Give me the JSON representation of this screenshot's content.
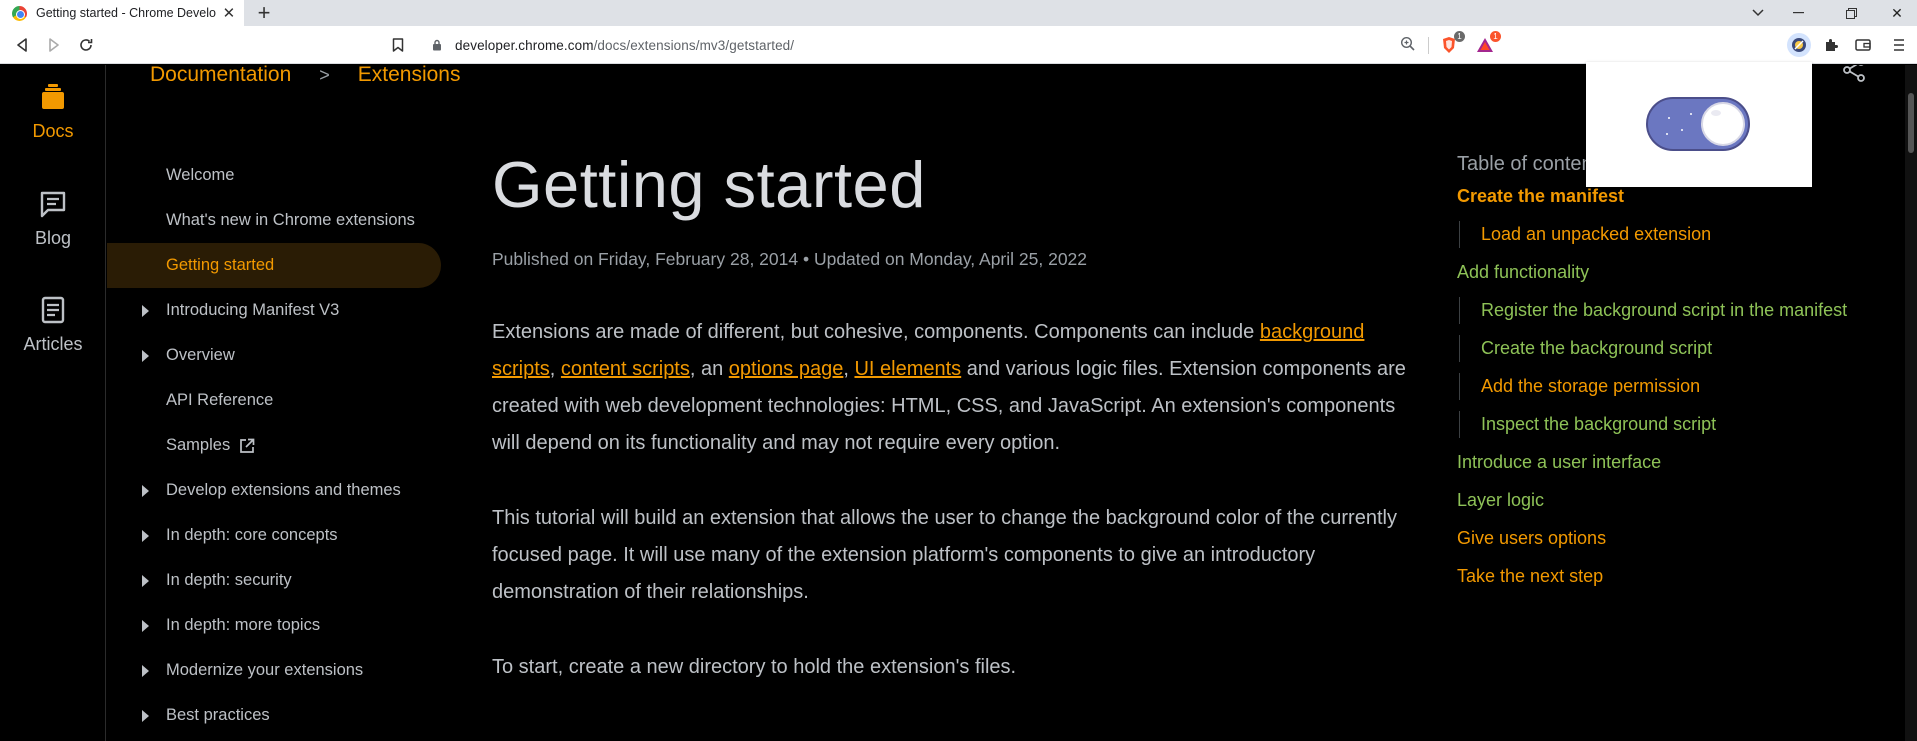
{
  "browser": {
    "tab_title": "Getting started - Chrome Developers",
    "url_host": "developer.chrome.com",
    "url_path": "/docs/extensions/mv3/getstarted/",
    "extension_badges": [
      "1",
      "1"
    ]
  },
  "rail": [
    {
      "label": "Docs",
      "icon": "docs-icon",
      "active": true
    },
    {
      "label": "Blog",
      "icon": "blog-icon",
      "active": false
    },
    {
      "label": "Articles",
      "icon": "articles-icon",
      "active": false
    }
  ],
  "breadcrumb": {
    "items": [
      "Documentation",
      "Extensions"
    ]
  },
  "sidenav": {
    "items": [
      {
        "label": "Welcome",
        "caret": false,
        "active": false
      },
      {
        "label": "What's new in Chrome extensions",
        "caret": false,
        "active": false
      },
      {
        "label": "Getting started",
        "caret": false,
        "active": true
      },
      {
        "label": "Introducing Manifest V3",
        "caret": true,
        "active": false
      },
      {
        "label": "Overview",
        "caret": true,
        "active": false
      },
      {
        "label": "API Reference",
        "caret": false,
        "active": false
      },
      {
        "label": "Samples",
        "caret": false,
        "active": false,
        "external": true
      },
      {
        "label": "Develop extensions and themes",
        "caret": true,
        "active": false
      },
      {
        "label": "In depth: core concepts",
        "caret": true,
        "active": false
      },
      {
        "label": "In depth: security",
        "caret": true,
        "active": false
      },
      {
        "label": "In depth: more topics",
        "caret": true,
        "active": false
      },
      {
        "label": "Modernize your extensions",
        "caret": true,
        "active": false
      },
      {
        "label": "Best practices",
        "caret": true,
        "active": false
      }
    ]
  },
  "article": {
    "title": "Getting started",
    "meta": "Published on Friday, February 28, 2014 • Updated on Monday, April 25, 2022",
    "p1": {
      "t1": "Extensions are made of different, but cohesive, components. Components can include ",
      "link1": "background scripts",
      "t2": ", ",
      "link2": "content scripts",
      "t3": ", an ",
      "link3": "options page",
      "t4": ", ",
      "link4": "UI elements",
      "t5": " and various logic files. Extension components are created with web development technologies: HTML, CSS, and JavaScript. An extension's components will depend on its functionality and may not require every option."
    },
    "p2": "This tutorial will build an extension that allows the user to change the background color of the currently focused page. It will use many of the extension platform's components to give an introductory demonstration of their relationships.",
    "p3": "To start, create a new directory to hold the extension's files."
  },
  "toc": {
    "title": "Table of contents",
    "items": [
      {
        "label": "Create the manifest",
        "level": 1,
        "color": "orange",
        "bold": true
      },
      {
        "label": "Load an unpacked extension",
        "level": 2,
        "color": "orange"
      },
      {
        "label": "Add functionality",
        "level": 1,
        "color": "green"
      },
      {
        "label": "Register the background script in the manifest",
        "level": 2,
        "color": "green"
      },
      {
        "label": "Create the background script",
        "level": 2,
        "color": "green"
      },
      {
        "label": "Add the storage permission",
        "level": 2,
        "color": "orange"
      },
      {
        "label": "Inspect the background script",
        "level": 2,
        "color": "green"
      },
      {
        "label": "Introduce a user interface",
        "level": 1,
        "color": "green"
      },
      {
        "label": "Layer logic",
        "level": 1,
        "color": "green"
      },
      {
        "label": "Give users options",
        "level": 1,
        "color": "orange"
      },
      {
        "label": "Take the next step",
        "level": 1,
        "color": "orange"
      }
    ]
  },
  "popup": {
    "toggle_on": true
  },
  "colors": {
    "accent": "#f29900",
    "toc_green": "#8ec257",
    "background": "#000000",
    "toggle": "#6b77c1"
  }
}
